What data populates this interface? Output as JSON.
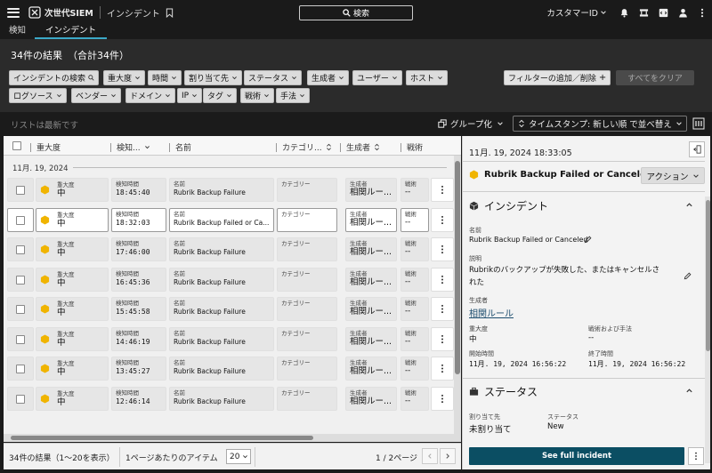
{
  "topbar": {
    "brand": "次世代SIEM",
    "crumb": "インシデント",
    "search_label": "検索",
    "customer_label": "カスタマーID"
  },
  "tabs": [
    {
      "label": "検知",
      "active": false
    },
    {
      "label": "インシデント",
      "active": true
    }
  ],
  "results": {
    "title": "34件の結果",
    "total": "（合計34件）"
  },
  "filters": {
    "row1": [
      "インシデントの検索",
      "重大度",
      "時間",
      "割り当て先",
      "ステータス",
      "生成者",
      "ユーザー",
      "ホスト"
    ],
    "row2": [
      "ログソース",
      "ベンダー",
      "ドメイン",
      "IP",
      "タグ",
      "戦術",
      "手法"
    ],
    "add_filter": "フィルターの追加／削除",
    "clear_all": "すべてをクリア"
  },
  "listbar": {
    "hint": "リストは最新です",
    "grouping": "グループ化",
    "sort_label": "タイムスタンプ: 新しい順 で並べ替え"
  },
  "table": {
    "columns": [
      "重大度",
      "検知...",
      "名前",
      "カテゴリ...",
      "生成者",
      "戦術"
    ],
    "date_group": "11月. 19, 2024",
    "field_labels": {
      "severity": "重大度",
      "time": "検知時間",
      "name": "名前",
      "category": "カテゴリー",
      "generator": "生成者",
      "tactic": "戦術"
    },
    "rows": [
      {
        "severity": "中",
        "time": "18:45:40",
        "name": "Rubrik Backup Failure",
        "category": "",
        "generator": "相関ルー...",
        "tactic": "--"
      },
      {
        "severity": "中",
        "time": "18:32:03",
        "name": "Rubrik Backup Failed or Ca...",
        "category": "",
        "generator": "相関ルー...",
        "tactic": "--"
      },
      {
        "severity": "中",
        "time": "17:46:00",
        "name": "Rubrik Backup Failure",
        "category": "",
        "generator": "相関ルー...",
        "tactic": "--"
      },
      {
        "severity": "中",
        "time": "16:45:36",
        "name": "Rubrik Backup Failure",
        "category": "",
        "generator": "相関ルー...",
        "tactic": "--"
      },
      {
        "severity": "中",
        "time": "15:45:58",
        "name": "Rubrik Backup Failure",
        "category": "",
        "generator": "相関ルー...",
        "tactic": "--"
      },
      {
        "severity": "中",
        "time": "14:46:19",
        "name": "Rubrik Backup Failure",
        "category": "",
        "generator": "相関ルー...",
        "tactic": "--"
      },
      {
        "severity": "中",
        "time": "13:45:27",
        "name": "Rubrik Backup Failure",
        "category": "",
        "generator": "相関ルー...",
        "tactic": "--"
      },
      {
        "severity": "中",
        "time": "12:46:14",
        "name": "Rubrik Backup Failure",
        "category": "",
        "generator": "相関ルー...",
        "tactic": "--"
      }
    ]
  },
  "pagination": {
    "count": "34件の結果（1～20を表示）",
    "per_page_label": "1ページあたりのアイテム",
    "per_page": "20",
    "pages": "1 / 2ページ"
  },
  "detail": {
    "timestamp": "11月. 19, 2024 18:33:05",
    "title": "Rubrik Backup Failed or Canceled",
    "action": "アクション",
    "section_incident": "インシデント",
    "name_label": "名前",
    "name_value": "Rubrik Backup Failed or Canceled",
    "desc_label": "説明",
    "desc_line1": "Rubrikのバックアップが失敗した、またはキャンセルさ",
    "desc_line2": "れた",
    "generator_label": "生成者",
    "generator_value": "相関ルール",
    "severity_label": "重大度",
    "severity_value": "中",
    "tactic_label": "戦術および手法",
    "tactic_value": "--",
    "start_label": "開始時間",
    "start_value": "11月. 19, 2024 16:56:22",
    "end_label": "終了時間",
    "end_value": "11月. 19, 2024 16:56:22",
    "section_status": "ステータス",
    "assignee_label": "割り当て先",
    "assignee_value": "未割り当て",
    "status_label": "ステータス",
    "status_value": "New",
    "full_button": "See full incident"
  },
  "colors": {
    "severity_medium": "#f0b400",
    "accent": "#0b4e63",
    "tab_underline": "#3ba9c8"
  }
}
